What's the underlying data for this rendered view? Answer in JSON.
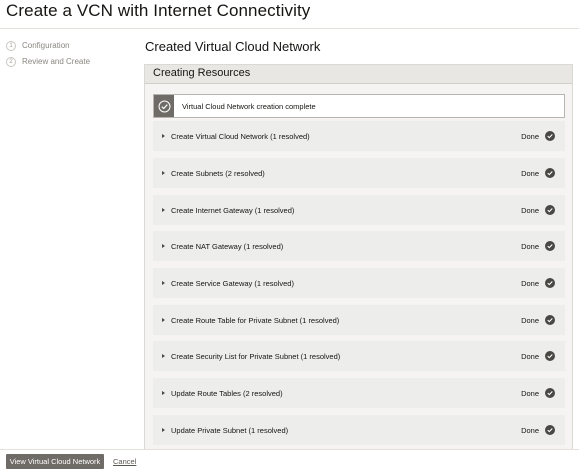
{
  "page": {
    "title": "Create a VCN with Internet Connectivity"
  },
  "steps": [
    {
      "num": "1",
      "label": "Configuration"
    },
    {
      "num": "2",
      "label": "Review and Create"
    }
  ],
  "section_heading": "Created Virtual Cloud Network",
  "panel": {
    "header": "Creating Resources",
    "banner": "Virtual Cloud Network creation complete",
    "tasks": [
      {
        "label": "Create Virtual Cloud Network (1 resolved)",
        "status": "Done"
      },
      {
        "label": "Create Subnets (2 resolved)",
        "status": "Done"
      },
      {
        "label": "Create Internet Gateway (1 resolved)",
        "status": "Done"
      },
      {
        "label": "Create NAT Gateway (1 resolved)",
        "status": "Done"
      },
      {
        "label": "Create Service Gateway (1 resolved)",
        "status": "Done"
      },
      {
        "label": "Create Route Table for Private Subnet (1 resolved)",
        "status": "Done"
      },
      {
        "label": "Create Security List for Private Subnet (1 resolved)",
        "status": "Done"
      },
      {
        "label": "Update Route Tables (2 resolved)",
        "status": "Done"
      },
      {
        "label": "Update Private Subnet (1 resolved)",
        "status": "Done"
      }
    ]
  },
  "footer": {
    "primary_button": "View Virtual Cloud Network",
    "cancel_link": "Cancel"
  },
  "colors": {
    "button": "#6f6c67",
    "done_icon": "#4a4844"
  }
}
